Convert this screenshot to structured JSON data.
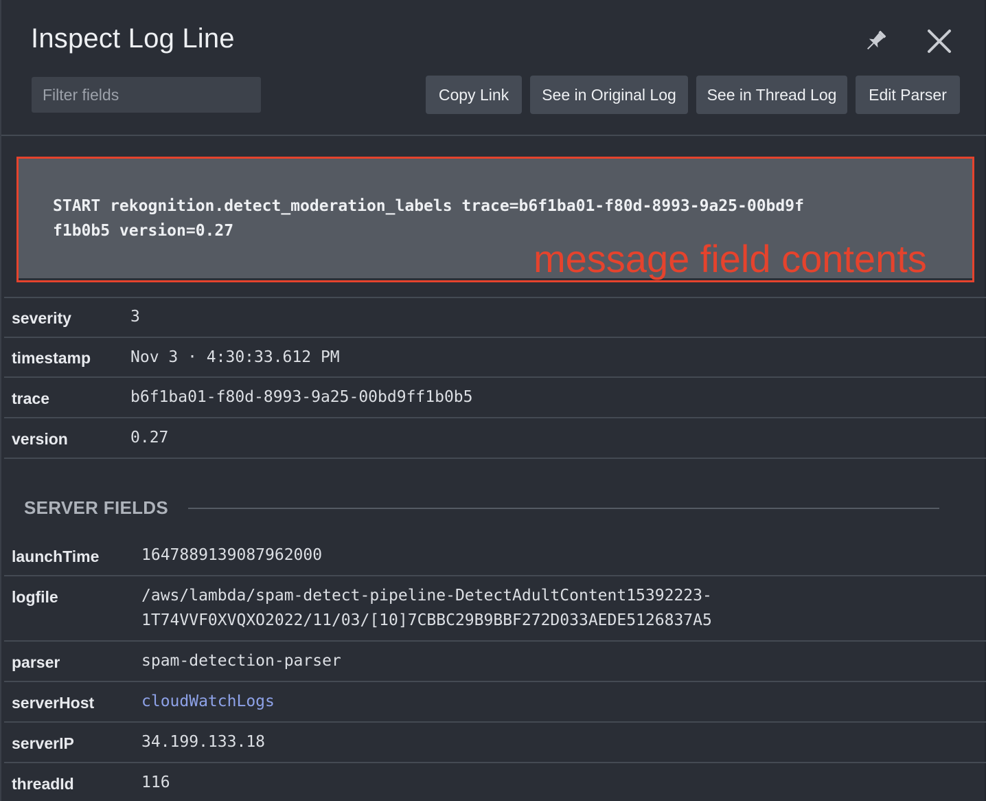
{
  "header": {
    "title": "Inspect Log Line",
    "pin_icon": "pin-icon",
    "close_icon": "close-icon"
  },
  "filter": {
    "placeholder": "Filter fields",
    "value": ""
  },
  "toolbar": {
    "copy_link": "Copy Link",
    "see_original": "See in Original Log",
    "see_thread": "See in Thread Log",
    "edit_parser": "Edit Parser"
  },
  "message": {
    "text": "START rekognition.detect_moderation_labels trace=b6f1ba01-f80d-8993-9a25-00bd9ff1b0b5 version=0.27",
    "annotation_label": "message field contents",
    "annotation_color": "#e5432d"
  },
  "fields": [
    {
      "key": "severity",
      "value": "3"
    },
    {
      "key": "timestamp",
      "value": "Nov 3 · 4:30:33.612 PM"
    },
    {
      "key": "trace",
      "value": "b6f1ba01-f80d-8993-9a25-00bd9ff1b0b5"
    },
    {
      "key": "version",
      "value": "0.27"
    }
  ],
  "server_section": {
    "title": "SERVER FIELDS",
    "fields": [
      {
        "key": "launchTime",
        "value": "1647889139087962000"
      },
      {
        "key": "logfile",
        "value": "/aws/lambda/spam-detect-pipeline-DetectAdultContent15392223-\n1T74VVF0XVQXO2022/11/03/[10]7CBBC29B9BBF272D033AEDE5126837A5"
      },
      {
        "key": "parser",
        "value": "spam-detection-parser"
      },
      {
        "key": "serverHost",
        "value": "cloudWatchLogs"
      },
      {
        "key": "serverIP",
        "value": "34.199.133.18"
      },
      {
        "key": "threadId",
        "value": "116"
      }
    ]
  },
  "colors": {
    "background": "#2a2e36",
    "button": "#454b55",
    "link": "#8ea2e8"
  }
}
